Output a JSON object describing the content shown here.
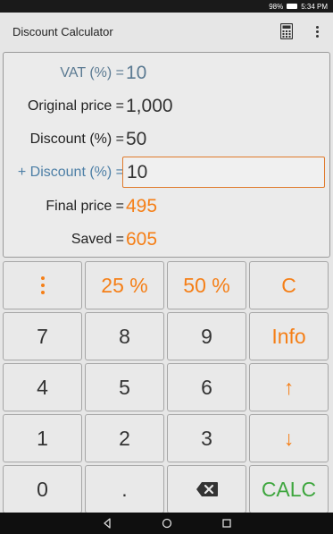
{
  "status": {
    "battery": "98%",
    "time": "5:34 PM"
  },
  "app": {
    "title": "Discount Calculator",
    "calc_icon": "calculator-icon",
    "more_icon": "more-vert-icon"
  },
  "fields": {
    "vat": {
      "label": "VAT (%) =",
      "value": "10"
    },
    "original": {
      "label": "Original price =",
      "value": "1,000"
    },
    "discount": {
      "label": "Discount (%) =",
      "value": "50"
    },
    "plus_discount": {
      "label": "+ Discount (%) =",
      "value": "10"
    },
    "final": {
      "label": "Final price =",
      "value": "495"
    },
    "saved": {
      "label": "Saved =",
      "value": "605"
    }
  },
  "keys": {
    "pct25": "25 %",
    "pct50": "50 %",
    "clear": "C",
    "k7": "7",
    "k8": "8",
    "k9": "9",
    "info": "Info",
    "k4": "4",
    "k5": "5",
    "k6": "6",
    "up": "↑",
    "k1": "1",
    "k2": "2",
    "k3": "3",
    "down": "↓",
    "k0": "0",
    "dot": ".",
    "calc": "CALC"
  },
  "colors": {
    "orange": "#f57f17",
    "green": "#3ea63e",
    "blue_label": "#5b7a92",
    "input_border": "#e07a2c"
  }
}
